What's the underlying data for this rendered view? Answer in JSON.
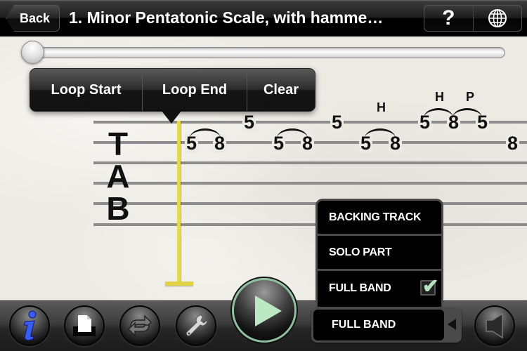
{
  "navbar": {
    "back_label": "Back",
    "title": "1. Minor Pentatonic Scale, with hamme…",
    "help_label": "?",
    "help_icon": "question-icon",
    "language_icon": "globe-icon"
  },
  "playback": {
    "progress": 0.0
  },
  "loop_popup": {
    "buttons": [
      "Loop Start",
      "Loop End",
      "Clear"
    ]
  },
  "tab": {
    "clef": [
      "T",
      "A",
      "B"
    ],
    "notes": [
      {
        "string": 2,
        "fret": "5"
      },
      {
        "string": 2,
        "fret": "8"
      },
      {
        "string": 1,
        "fret": "5"
      },
      {
        "string": 2,
        "fret": "5"
      },
      {
        "string": 2,
        "fret": "8"
      },
      {
        "string": 1,
        "fret": "5"
      },
      {
        "string": 2,
        "fret": "5"
      },
      {
        "string": 2,
        "fret": "8"
      },
      {
        "string": 1,
        "fret": "5"
      },
      {
        "string": 1,
        "fret": "8"
      },
      {
        "string": 1,
        "fret": "5"
      },
      {
        "string": 2,
        "fret": "8"
      }
    ],
    "techniques": [
      "H",
      "H",
      "P"
    ]
  },
  "track_menu": {
    "options": [
      {
        "label": "BACKING TRACK",
        "selected": false
      },
      {
        "label": "SOLO PART",
        "selected": false
      },
      {
        "label": "FULL BAND",
        "selected": true
      }
    ],
    "current": "FULL BAND"
  },
  "toolbar": {
    "buttons": [
      {
        "name": "info",
        "icon": "info-icon"
      },
      {
        "name": "print",
        "icon": "print-icon"
      },
      {
        "name": "loop",
        "icon": "repeat-icon"
      },
      {
        "name": "settings",
        "icon": "wrench-icon"
      },
      {
        "name": "play",
        "icon": "play-icon"
      },
      {
        "name": "volume",
        "icon": "speaker-icon"
      }
    ]
  },
  "colors": {
    "playhead": "#e8d94a",
    "play_accent": "#bde8c4",
    "info_blue": "#2f4fe0"
  }
}
